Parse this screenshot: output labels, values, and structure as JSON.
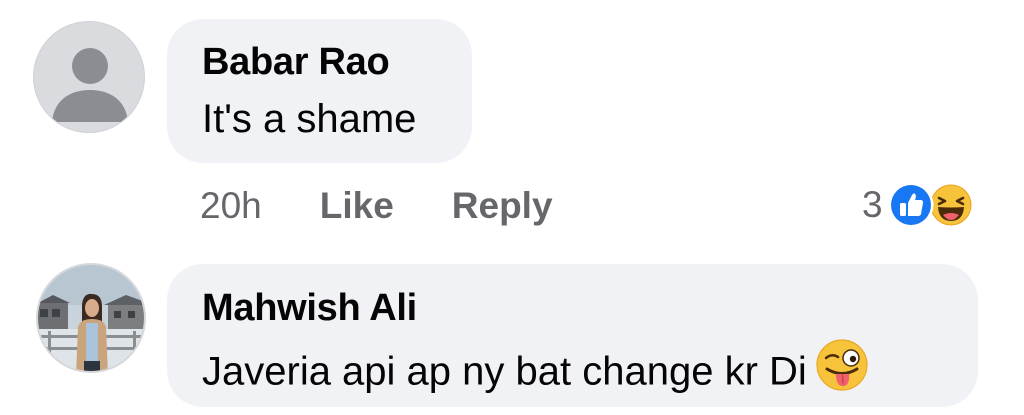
{
  "comments": [
    {
      "author": "Babar Rao",
      "text": "It's a shame",
      "time": "20h",
      "like_label": "Like",
      "reply_label": "Reply",
      "reaction_count": "3",
      "reactions": [
        "like-icon",
        "laughing-face-icon"
      ],
      "avatar": "default-user-avatar"
    },
    {
      "author": "Mahwish Ali",
      "text": "Javeria api ap ny bat change kr Di",
      "emoji": "winking-tongue-face-icon",
      "avatar": "profile-photo-avatar"
    }
  ],
  "colors": {
    "bubble": "#f0f2f5",
    "name": "#050505",
    "meta": "#65676b",
    "like_blue": "#1877f2",
    "emoji_yellow": "#f7c33a"
  }
}
